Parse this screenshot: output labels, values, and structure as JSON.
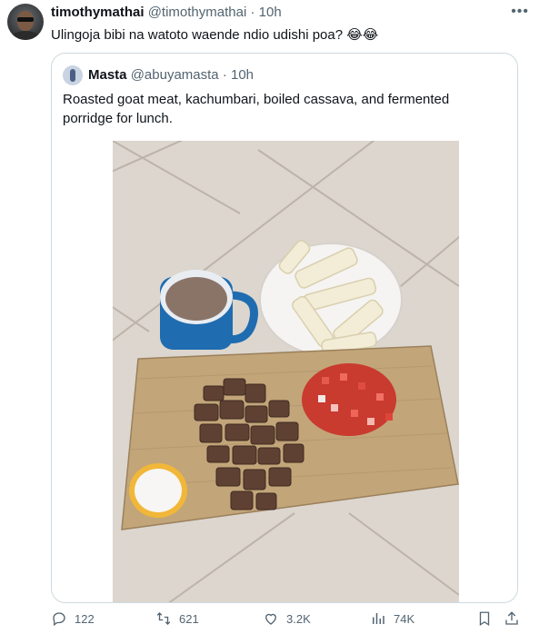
{
  "tweet": {
    "author_name": "timothymathai",
    "author_handle": "@timothymathai",
    "separator": "·",
    "time": "10h",
    "text": "Ulingoja bibi na watoto waende ndio udishi poa? 😂😂",
    "more_icon": "more-icon"
  },
  "quoted": {
    "author_name": "Masta",
    "author_handle": "@abuyamasta",
    "separator": "·",
    "time": "10h",
    "text": "Roasted goat meat, kachumbari, boiled cassava, and fermented porridge for lunch."
  },
  "actions": {
    "replies": "122",
    "reposts": "621",
    "likes": "3.2K",
    "views": "74K"
  },
  "colors": {
    "text": "#0f1419",
    "muted": "#536471",
    "border": "#cfd9de"
  }
}
